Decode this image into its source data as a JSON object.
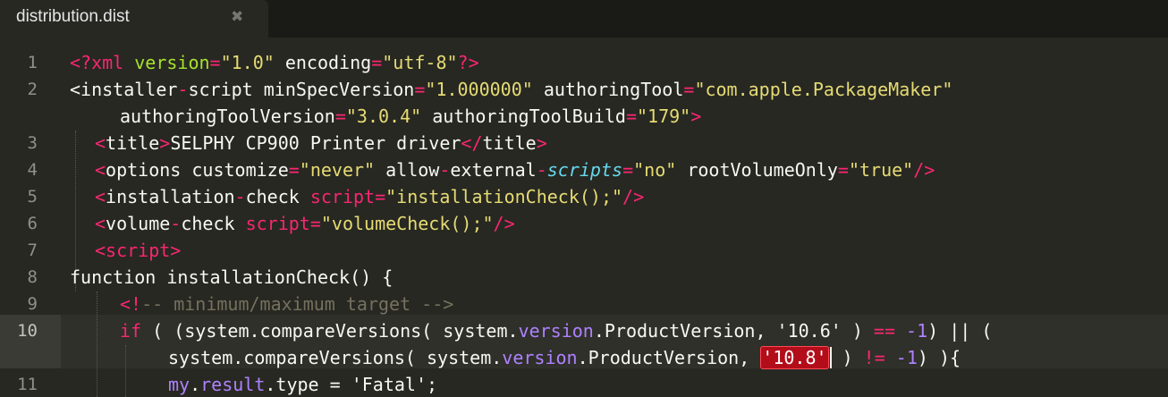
{
  "tab": {
    "title": "distribution.dist",
    "close_glyph": "✖"
  },
  "gutter": {
    "numbers": [
      "1",
      "2",
      "3",
      "4",
      "5",
      "6",
      "7",
      "8",
      "9",
      "10",
      "11"
    ],
    "active_line": "10"
  },
  "lines": {
    "l1": [
      "<?xml ",
      "version",
      "=",
      "\"1.0\"",
      " encoding",
      "=",
      "\"utf-8\"",
      "?>"
    ],
    "l2a": [
      "<installer",
      "-",
      "script",
      " minSpecVersion",
      "=",
      "\"1.000000\"",
      " authoringTool",
      "=",
      "\"com.apple.PackageMaker\""
    ],
    "l2b": [
      "authoringToolVersion",
      "=",
      "\"3.0.4\"",
      " authoringToolBuild",
      "=",
      "\"179\"",
      ">"
    ],
    "l3": [
      "<",
      "title",
      ">",
      "SELPHY CP900 Printer driver",
      "</",
      "title",
      ">"
    ],
    "l4": [
      "<",
      "options customize",
      "=",
      "\"never\"",
      " allow",
      "-",
      "external",
      "-",
      "scripts",
      "=",
      "\"no\"",
      " rootVolumeOnly",
      "=",
      "\"true\"",
      "/>"
    ],
    "l5": [
      "<",
      "installation",
      "-",
      "check ",
      "script",
      "=",
      "\"installationCheck();\"",
      "/>"
    ],
    "l6": [
      "<",
      "volume",
      "-",
      "check ",
      "script",
      "=",
      "\"volumeCheck();\"",
      "/>"
    ],
    "l7": [
      "<script>"
    ],
    "l8": [
      "function installationCheck() {"
    ],
    "l9": [
      "<!",
      "-- minimum/maximum target -->"
    ],
    "l10a": [
      "if",
      " ( (system.compareVersions( system.",
      "version",
      ".ProductVersion, ",
      "'10.6'",
      " ) ",
      "==",
      " ",
      "-1",
      ") || ("
    ],
    "l10b": [
      "system.compareVersions( system.",
      "version",
      ".ProductVersion, ",
      "'10.8'",
      " ) ",
      "!=",
      " ",
      "-1",
      ") ){"
    ],
    "l11": [
      "my",
      ".",
      "result",
      ".type = ",
      "'Fatal'",
      ";"
    ]
  },
  "colors": {
    "background": "#272822",
    "keyword": "#f92672",
    "attribute": "#a6e22e",
    "string": "#e6db74",
    "comment": "#75715e",
    "function": "#66d9ef",
    "number": "#ae81ff",
    "selection": "#b30d1a"
  }
}
